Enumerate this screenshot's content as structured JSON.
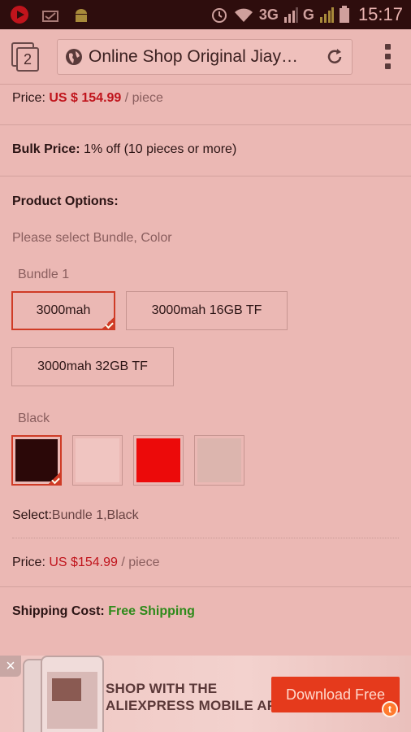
{
  "status_bar": {
    "time": "15:17",
    "network_3g": "3G",
    "network_g": "G",
    "icons": [
      "youtube-icon",
      "data-icon",
      "android-icon",
      "alarm-icon",
      "wifi-icon",
      "signal-icon",
      "battery-icon"
    ]
  },
  "browser": {
    "tab_count": "2",
    "url_title": "Online Shop Original Jiay…"
  },
  "product": {
    "price_label": "Price:",
    "price_value": "US $ 154.99",
    "price_unit": "/ piece",
    "bulk_label": "Bulk Price:",
    "bulk_value": "1% off (10 pieces or more)",
    "options_label": "Product Options:",
    "options_hint": "Please select Bundle, Color",
    "bundle_label": "Bundle 1",
    "bundles": [
      "3000mah",
      "3000mah 16GB TF",
      "3000mah 32GB TF"
    ],
    "color_label": "Black",
    "colors": [
      "#2b0808",
      "#f0c5c1",
      "#ec0a0a",
      "#dcb5ae"
    ],
    "select_label": "Select:",
    "select_value": "Bundle 1,Black",
    "price2_label": "Price:",
    "price2_value": "US $154.99",
    "price2_unit": "/ piece",
    "shipping_label": "Shipping Cost:",
    "shipping_value": "Free Shipping"
  },
  "banner": {
    "line1": "SHOP WITH THE",
    "line2": "ALIEXPRESS MOBILE APP",
    "button": "Download Free",
    "badge": "t",
    "close": "×"
  },
  "colors": {
    "accent_red": "#c0141c",
    "select_border": "#cf3b26",
    "free_green": "#2e8a1a"
  }
}
